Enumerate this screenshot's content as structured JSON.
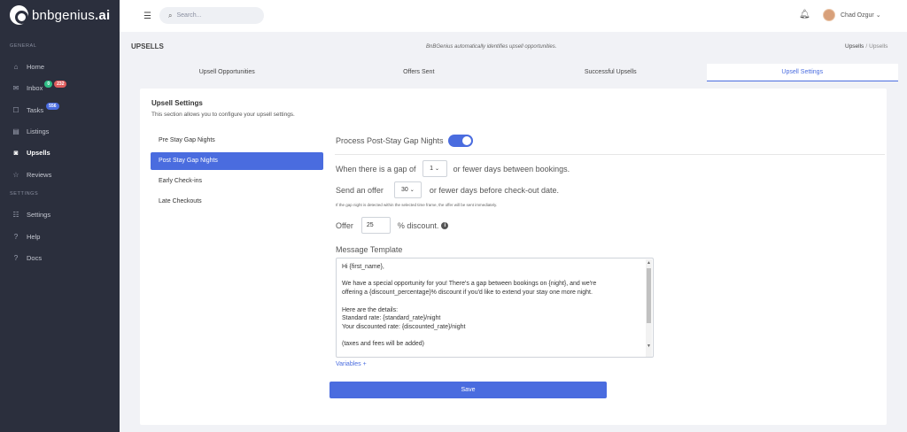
{
  "app": {
    "logo_text": "bnbgenius",
    "logo_suffix": ".ai"
  },
  "sidebar": {
    "sections": [
      "GENERAL",
      "SETTINGS"
    ],
    "items": [
      {
        "label": "Home",
        "icon": "home-icon"
      },
      {
        "label": "Inbox",
        "icon": "inbox-icon",
        "badges": [
          {
            "text": "0",
            "color": "#2ebd85"
          },
          {
            "text": "232",
            "color": "#e05d5d"
          }
        ]
      },
      {
        "label": "Tasks",
        "icon": "tasks-icon",
        "badges": [
          {
            "text": "556",
            "color": "#4a6cdf"
          }
        ]
      },
      {
        "label": "Listings",
        "icon": "listings-icon"
      },
      {
        "label": "Upsells",
        "icon": "upsells-icon",
        "active": true
      },
      {
        "label": "Reviews",
        "icon": "star-icon"
      },
      {
        "label": "Settings",
        "icon": "sliders-icon"
      },
      {
        "label": "Help",
        "icon": "help-icon"
      },
      {
        "label": "Docs",
        "icon": "docs-icon"
      }
    ]
  },
  "topbar": {
    "search_placeholder": "Search...",
    "user_name": "Chad Ozgur"
  },
  "page": {
    "title": "UPSELLS",
    "description": "BnBGenius automatically identifies upsell opportunities.",
    "breadcrumb": [
      "Upsells",
      "Upsells"
    ]
  },
  "tabs": [
    "Upsell Opportunities",
    "Offers Sent",
    "Successful Upsells",
    "Upsell Settings"
  ],
  "active_tab": 3,
  "settings": {
    "title": "Upsell Settings",
    "subtitle": "This section allows you to configure your upsell settings.",
    "menu": [
      "Pre Stay Gap Nights",
      "Post Stay Gap Nights",
      "Early Check-ins",
      "Late Checkouts"
    ],
    "active_menu": 1,
    "process_label": "Process Post-Stay Gap Nights",
    "toggle_on": true,
    "gap_prefix": "When there is a gap of",
    "gap_value": "1",
    "gap_suffix": "or fewer days between bookings.",
    "offer_prefix": "Send an offer",
    "offer_value": "30",
    "offer_suffix": "or fewer days before check-out date.",
    "note": "If the gap night is detected within the selected time frame, the offer will be sent immediately.",
    "discount_prefix": "Offer",
    "discount_value": "25",
    "discount_suffix": "% discount.",
    "template_label": "Message Template",
    "template_lines": [
      "Hi {first_name},",
      "",
      "We have a special opportunity for you! There's a gap between bookings on {night}, and we're",
      "offering a {discount_percentage}% discount if you'd like to extend your stay one more night.",
      "",
      "Here are the details:",
      "Standard rate: {standard_rate}/night",
      "Your discounted rate: {discounted_rate}/night",
      "",
      "(taxes and fees will be added)"
    ],
    "variables_link": "Variables +",
    "save_label": "Save"
  }
}
